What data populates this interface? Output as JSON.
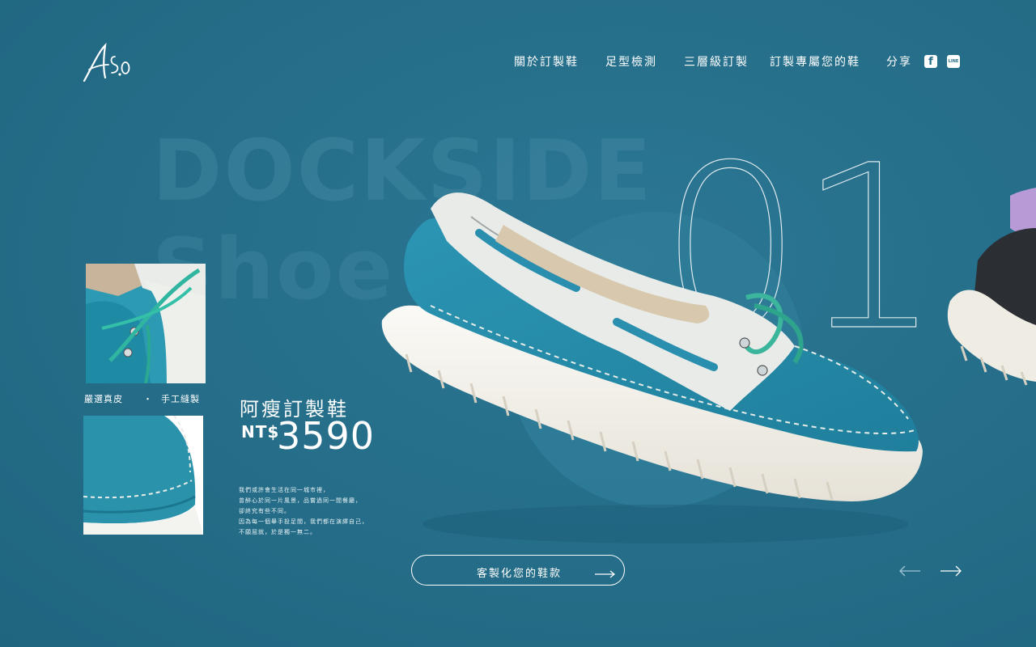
{
  "brand": {
    "logo_text": "A.S.O"
  },
  "nav": {
    "items": [
      "關於訂製鞋",
      "足型檢測",
      "三層級訂製",
      "訂製專屬您的鞋"
    ],
    "share_label": "分享",
    "facebook_glyph": "f",
    "line_glyph": "LINE"
  },
  "hero": {
    "bg_title_line1": "DOCKSIDE",
    "bg_title_line2": "Shoe",
    "slide_number": "01"
  },
  "features": {
    "left": "嚴選真皮",
    "separator": "・",
    "right": "手工縫製"
  },
  "product": {
    "name": "阿瘦訂製鞋",
    "currency": "NT$",
    "price": "3590",
    "description": [
      "我們或許會生活在同一城市裡，",
      "曾醉心於同一片風景，品嘗過同一間餐廳，",
      "卻終究有些不同。",
      "因為每一個舉手投足間，我們都在演繹自己，",
      "不願屈就，於是獨一無二。"
    ]
  },
  "cta": {
    "label": "客製化您的鞋款"
  },
  "carousel": {
    "prev_icon": "arrow-left-icon",
    "next_icon": "arrow-right-icon"
  },
  "colors": {
    "background": "#266f8a",
    "leather_teal": "#2a8fae",
    "sole_white": "#f2f0ea",
    "accent_white": "#ffffff"
  }
}
